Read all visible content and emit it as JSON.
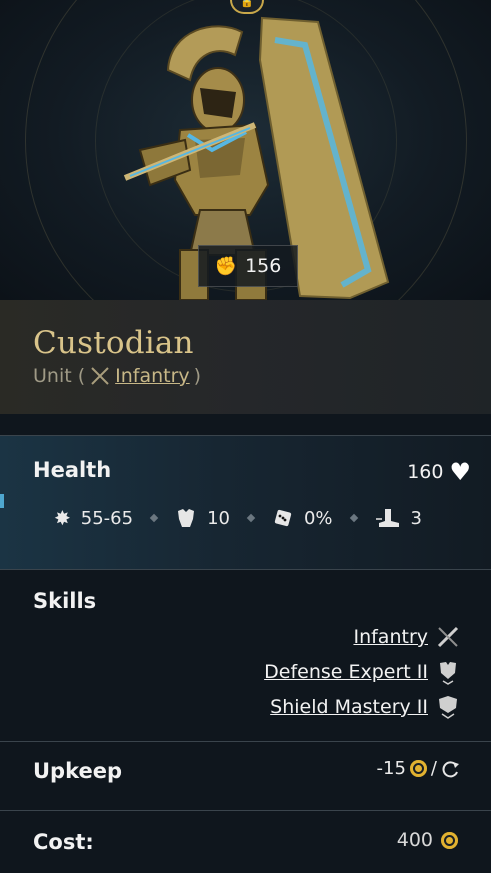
{
  "unit": {
    "power": "156",
    "name": "Custodian",
    "type_prefix": "Unit (",
    "type_link": "Infantry",
    "type_suffix": ")"
  },
  "health": {
    "label": "Health",
    "value": "160"
  },
  "stats": [
    {
      "icon": "damage-icon",
      "value": "55-65"
    },
    {
      "icon": "armor-icon",
      "value": "10"
    },
    {
      "icon": "dice-icon",
      "value": "0%"
    },
    {
      "icon": "movement-icon",
      "value": "3"
    }
  ],
  "skills": {
    "label": "Skills",
    "items": [
      {
        "name": "Infantry",
        "icon": "infantry-skill-icon"
      },
      {
        "name": "Defense Expert II",
        "icon": "defense-expert-icon"
      },
      {
        "name": "Shield Mastery II",
        "icon": "shield-mastery-icon"
      }
    ]
  },
  "upkeep": {
    "label": "Upkeep",
    "value": "-15",
    "per": "/"
  },
  "cost": {
    "label": "Cost:",
    "value": "400"
  },
  "colors": {
    "gold": "#e2b230",
    "title_gold": "#d9c48a",
    "accent_blue": "#4fa7cf"
  }
}
